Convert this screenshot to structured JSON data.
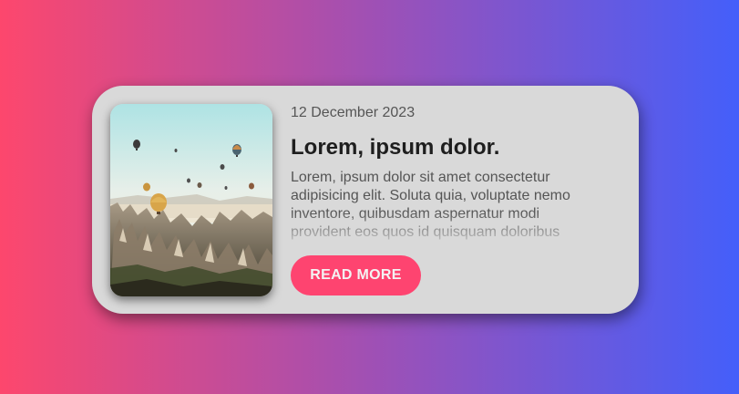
{
  "card": {
    "date": "12 December 2023",
    "title": "Lorem, ipsum dolor.",
    "excerpt": "Lorem, ipsum dolor sit amet consectetur adipisicing elit. Soluta quia, voluptate nemo inventore, quibusdam aspernatur modi provident eos quos id quisquam doloribus",
    "button_label": "READ MORE",
    "image": "hot-air-balloons-over-rock-valley-photo"
  },
  "colors": {
    "background_left": "#fd476d",
    "background_mid": "#a050b4",
    "background_right": "#445ffa",
    "card": "#d9d9d9",
    "button": "#fe4470",
    "title": "#1e1e1e",
    "text": "#555555"
  }
}
